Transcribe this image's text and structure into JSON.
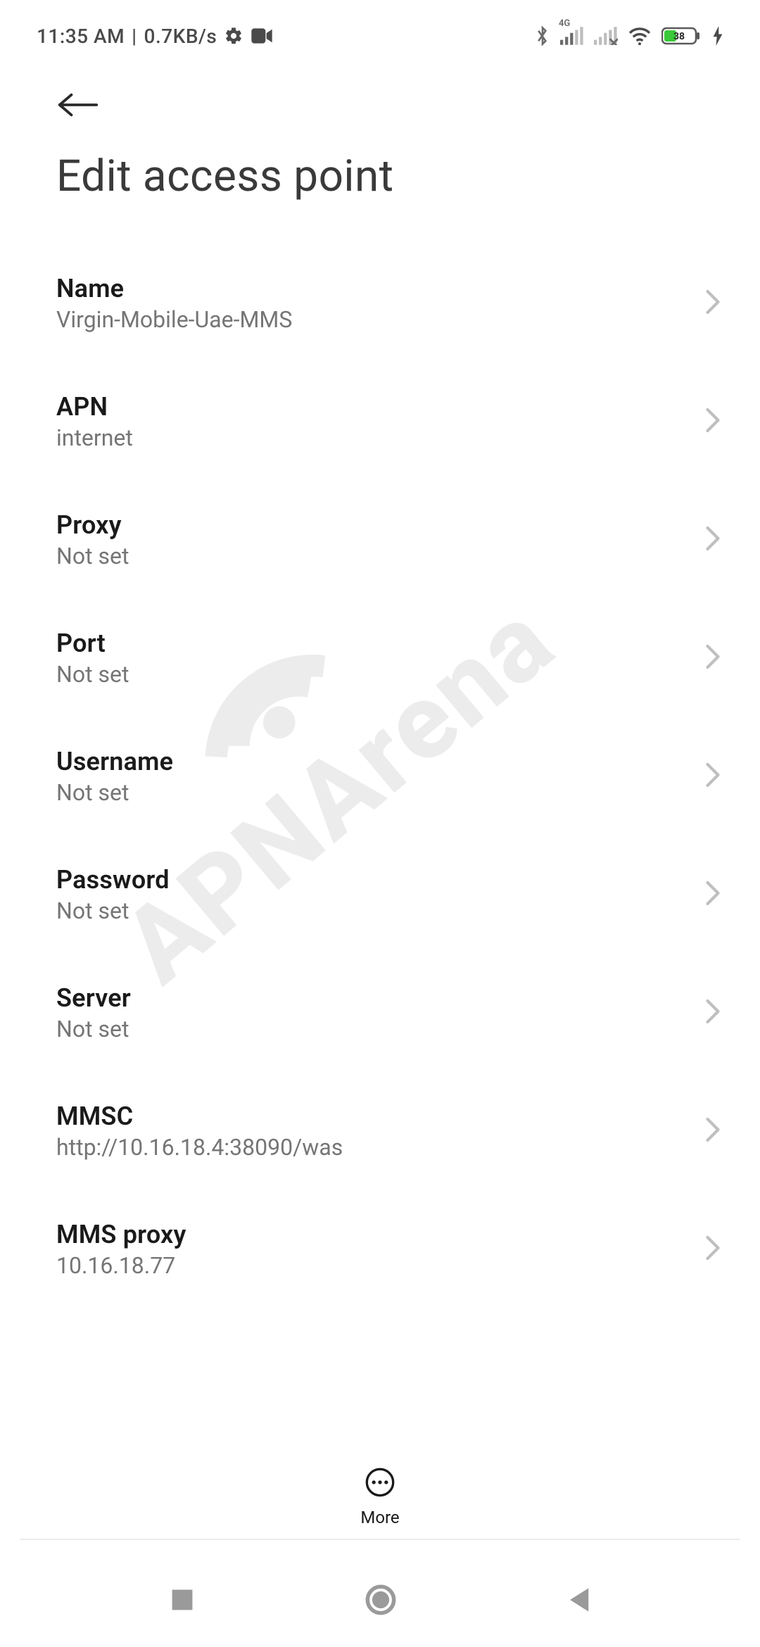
{
  "status_bar": {
    "time": "11:35 AM",
    "separator": "|",
    "data_rate": "0.7KB/s",
    "battery_percent": "38",
    "network_label": "4G"
  },
  "page": {
    "title": "Edit access point"
  },
  "fields": [
    {
      "label": "Name",
      "value": "Virgin-Mobile-Uae-MMS"
    },
    {
      "label": "APN",
      "value": "internet"
    },
    {
      "label": "Proxy",
      "value": "Not set"
    },
    {
      "label": "Port",
      "value": "Not set"
    },
    {
      "label": "Username",
      "value": "Not set"
    },
    {
      "label": "Password",
      "value": "Not set"
    },
    {
      "label": "Server",
      "value": "Not set"
    },
    {
      "label": "MMSC",
      "value": "http://10.16.18.4:38090/was"
    },
    {
      "label": "MMS proxy",
      "value": "10.16.18.77"
    }
  ],
  "more_button": {
    "label": "More"
  },
  "watermark": {
    "text": "APNArena"
  }
}
